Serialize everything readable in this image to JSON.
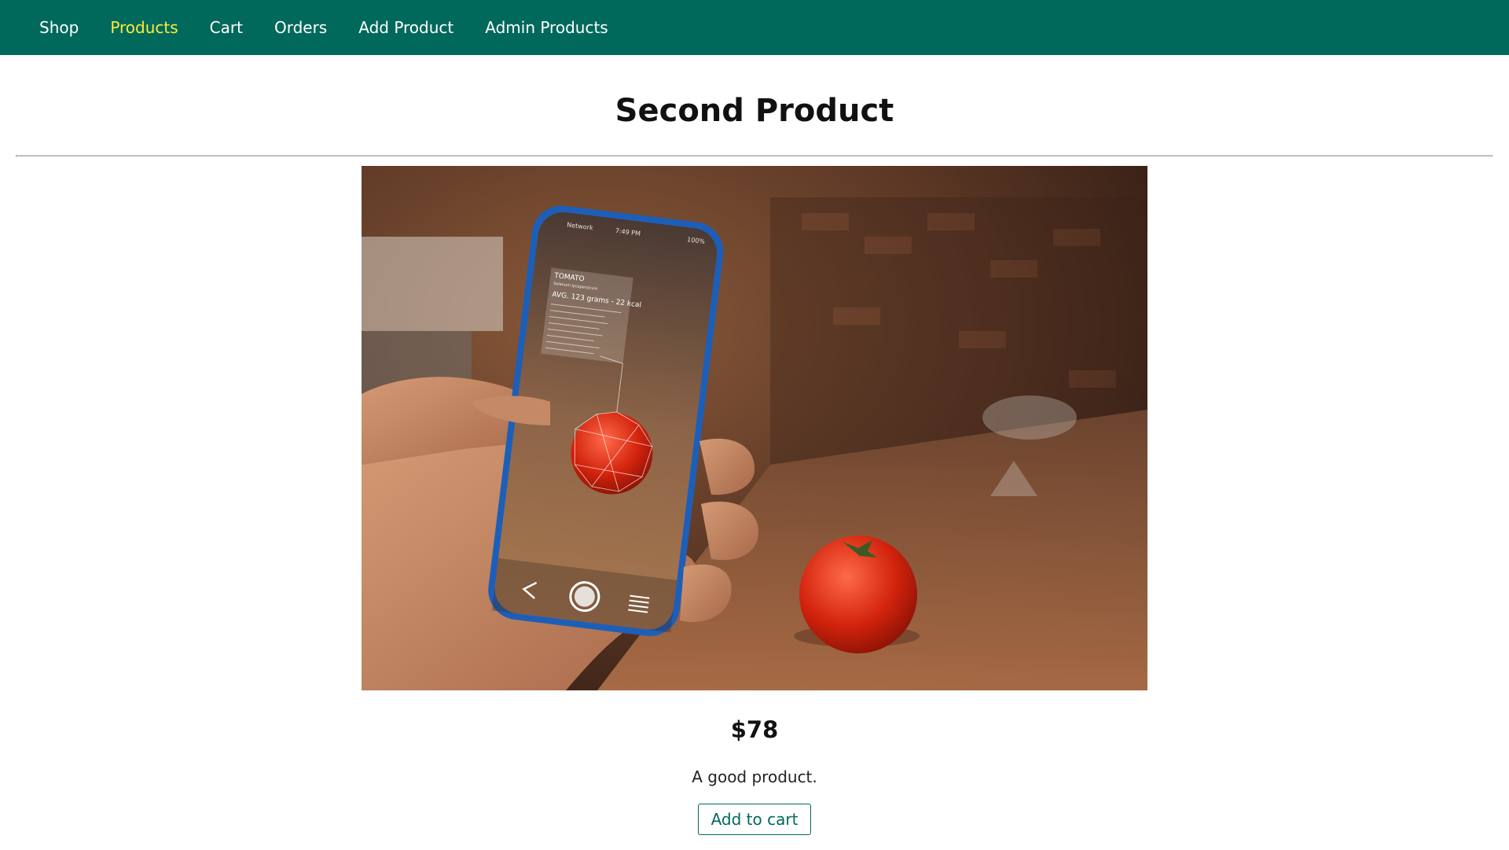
{
  "nav": {
    "items": [
      {
        "label": "Shop",
        "active": false
      },
      {
        "label": "Products",
        "active": true
      },
      {
        "label": "Cart",
        "active": false
      },
      {
        "label": "Orders",
        "active": false
      },
      {
        "label": "Add Product",
        "active": false
      },
      {
        "label": "Admin Products",
        "active": false
      }
    ]
  },
  "product": {
    "title": "Second Product",
    "price": "$78",
    "description": "A good product.",
    "add_to_cart_label": "Add to cart",
    "image": {
      "phone_status_left": "Network",
      "phone_status_time": "7:49 PM",
      "phone_status_battery": "100%",
      "ar_label_title": "TOMATO",
      "ar_label_subtitle": "Solanum lycopersicum",
      "ar_label_headline": "AVG. 123 grams - 22 kcal"
    }
  },
  "colors": {
    "header": "#00695c",
    "active_nav": "#ffeb3b",
    "button_border": "#00695c"
  }
}
